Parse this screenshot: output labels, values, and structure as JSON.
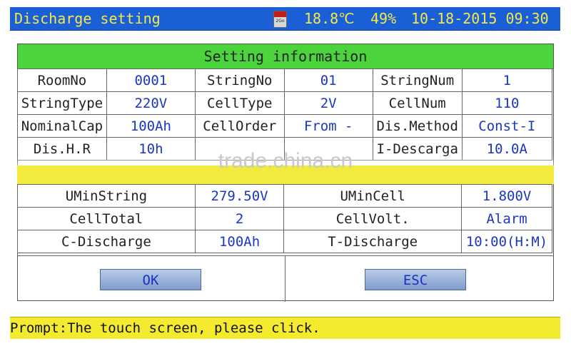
{
  "titlebar": {
    "title": "Discharge setting",
    "temperature": "18.8℃",
    "battery": "49%",
    "datetime": "10-18-2015 09:30",
    "sd_icon": "sd-card-icon",
    "sd_text": "2Go"
  },
  "setting_header": "Setting information",
  "upper_rows": [
    [
      "RoomNo",
      "0001",
      "StringNo",
      "01",
      "StringNum",
      "1"
    ],
    [
      "StringType",
      "220V",
      "CellType",
      "2V",
      "CellNum",
      "110"
    ],
    [
      "NominalCap",
      "100Ah",
      "CellOrder",
      "From -",
      "Dis.Method",
      "Const-I"
    ],
    [
      "Dis.H.R",
      "10h",
      "",
      "",
      "I-Descarga",
      "10.0A"
    ]
  ],
  "watermark": "trade.china.cn",
  "lower_rows": [
    [
      "UMinString",
      "279.50V",
      "UMinCell",
      "1.800V"
    ],
    [
      "CellTotal",
      "2",
      "CellVolt.",
      "Alarm"
    ],
    [
      "C-Discharge",
      "100Ah",
      "T-Discharge",
      "10:00(H:M)"
    ]
  ],
  "buttons": {
    "ok": "OK",
    "esc": "ESC"
  },
  "prompt": "Prompt:The touch screen, please click.",
  "colors": {
    "titlebar_bg": "#1b5fd6",
    "title_text": "#f6e84a",
    "header_bg": "#4bd43b",
    "value_text": "#1a35c8",
    "prompt_bg": "#f4ea2e"
  }
}
